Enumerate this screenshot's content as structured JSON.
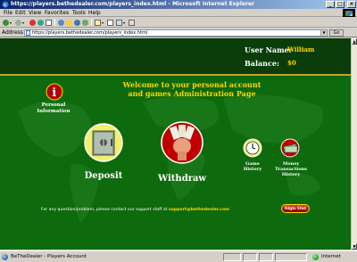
{
  "window": {
    "title": "https://players.bethedealer.com/players_index.html - Microsoft Internet Explorer"
  },
  "menu": [
    "File",
    "Edit",
    "View",
    "Favorites",
    "Tools",
    "Help"
  ],
  "address": {
    "label": "Address",
    "url": "https://players.bethedealer.com/players_index.html",
    "go": "Go"
  },
  "header": {
    "username_label": "User Name:",
    "username": "William",
    "balance_label": "Balance:",
    "balance": "$0"
  },
  "welcome": {
    "line1": "Welcome to your personal account",
    "line2": "and games Administration Page"
  },
  "nav": {
    "personal_info": "Personal Information",
    "deposit": "Deposit",
    "withdraw": "Withdraw",
    "game_history": "Game History",
    "money_history": "Money Transactions History",
    "sign_out": "Sign Out"
  },
  "footer": {
    "text": "For any question/problem, please contact our support staff at",
    "email": "support@bethedealer.com"
  },
  "status": {
    "text": "BeTheDealer - Players Account",
    "zone": "Internet"
  },
  "colors": {
    "page_bg": "#0d6a0d",
    "header_bg": "#0a3d0a",
    "accent_gold": "#ffd700",
    "button_red": "#b00000"
  }
}
